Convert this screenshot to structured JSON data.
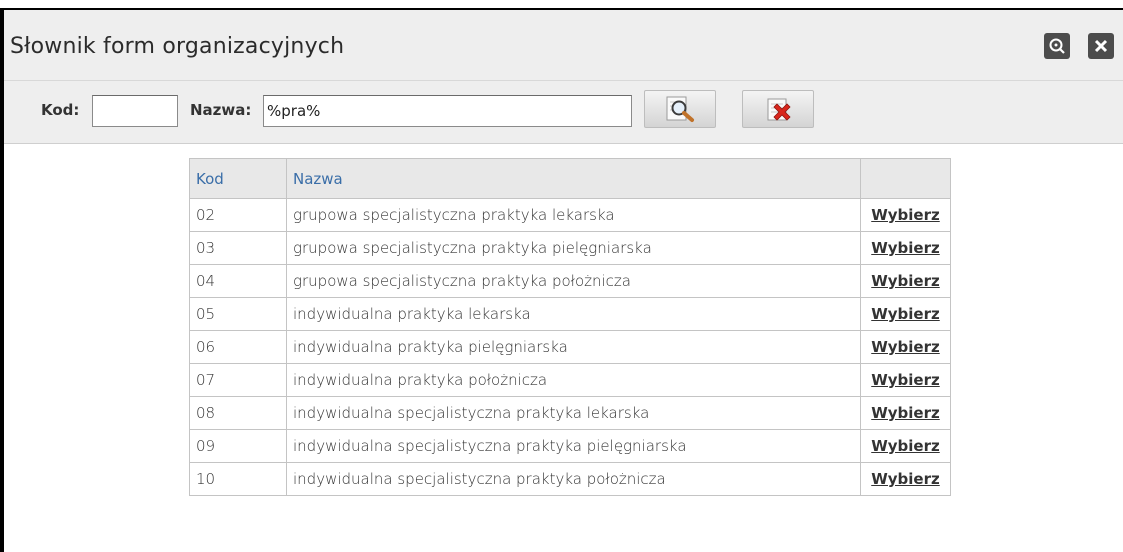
{
  "window": {
    "title": "Słownik form organizacyjnych",
    "buttons": [
      {
        "name": "zoom",
        "icon": "zoom-icon"
      },
      {
        "name": "close",
        "icon": "close-icon"
      }
    ]
  },
  "filter": {
    "kod_label": "Kod:",
    "kod_value": "",
    "nazwa_label": "Nazwa:",
    "nazwa_value": "%pra%",
    "search_icon": "magnifier-icon",
    "clear_icon": "clear-filter-icon"
  },
  "table": {
    "headers": [
      "Kod",
      "Nazwa",
      ""
    ],
    "rows": [
      {
        "kod": "02",
        "nazwa": "grupowa specjalistyczna praktyka lekarska",
        "action": "Wybierz"
      },
      {
        "kod": "03",
        "nazwa": "grupowa specjalistyczna praktyka pielęgniarska",
        "action": "Wybierz"
      },
      {
        "kod": "04",
        "nazwa": "grupowa specjalistyczna praktyka położnicza",
        "action": "Wybierz"
      },
      {
        "kod": "05",
        "nazwa": "indywidualna praktyka lekarska",
        "action": "Wybierz"
      },
      {
        "kod": "06",
        "nazwa": "indywidualna praktyka pielęgniarska",
        "action": "Wybierz"
      },
      {
        "kod": "07",
        "nazwa": "indywidualna praktyka położnicza",
        "action": "Wybierz"
      },
      {
        "kod": "08",
        "nazwa": "indywidualna specjalistyczna praktyka lekarska",
        "action": "Wybierz"
      },
      {
        "kod": "09",
        "nazwa": "indywidualna specjalistyczna praktyka pielęgniarska",
        "action": "Wybierz"
      },
      {
        "kod": "10",
        "nazwa": "indywidualna specjalistyczna praktyka położnicza",
        "action": "Wybierz"
      }
    ]
  },
  "colors": {
    "header_text": "#3a6ea8",
    "bar_background": "#eeeeee",
    "title_button_bg": "#4c4c4c",
    "clear_icon_red": "#d9261c"
  }
}
